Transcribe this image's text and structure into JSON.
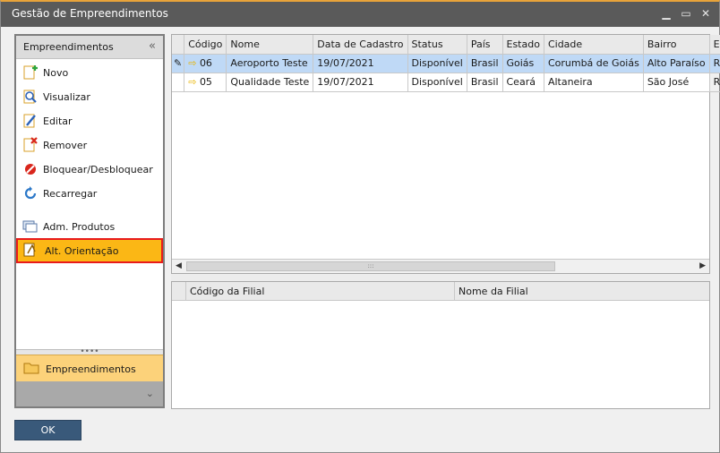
{
  "window": {
    "title": "Gestão de Empreendimentos"
  },
  "nav": {
    "header": "Empreendimentos",
    "items": [
      {
        "label": "Novo",
        "icon": "new-doc-icon"
      },
      {
        "label": "Visualizar",
        "icon": "view-icon"
      },
      {
        "label": "Editar",
        "icon": "edit-icon"
      },
      {
        "label": "Remover",
        "icon": "remove-icon"
      },
      {
        "label": "Bloquear/Desbloquear",
        "icon": "block-icon"
      },
      {
        "label": "Recarregar",
        "icon": "reload-icon"
      },
      {
        "label": "Adm. Produtos",
        "icon": "products-icon"
      },
      {
        "label": "Alt. Orientação",
        "icon": "orientation-icon"
      }
    ],
    "group": "Empreendimentos"
  },
  "grid": {
    "columns": [
      "Código",
      "Nome",
      "Data de Cadastro",
      "Status",
      "País",
      "Estado",
      "Cidade",
      "Bairro",
      "End"
    ],
    "rows": [
      [
        "06",
        "Aeroporto Teste",
        "19/07/2021",
        "Disponível",
        "Brasil",
        "Goiás",
        "Corumbá de Goiás",
        "Alto Paraíso",
        "Rua"
      ],
      [
        "05",
        "Qualidade Teste",
        "19/07/2021",
        "Disponível",
        "Brasil",
        "Ceará",
        "Altaneira",
        "São José",
        "Rua"
      ]
    ]
  },
  "subgrid": {
    "columns": [
      "Código da Filial",
      "Nome da Filial"
    ]
  },
  "buttons": {
    "ok": "OK"
  }
}
